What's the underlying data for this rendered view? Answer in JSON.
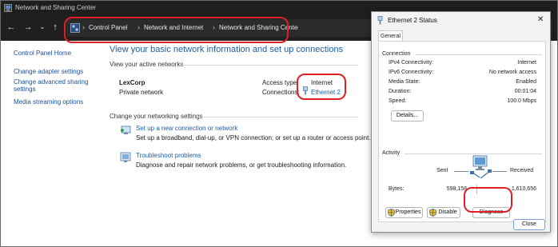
{
  "window": {
    "title": "Network and Sharing Center"
  },
  "address_bar": {
    "crumbs": [
      "Control Panel",
      "Network and Internet",
      "Network and Sharing Center"
    ]
  },
  "left_nav": [
    "Control Panel Home",
    "Change adapter settings",
    "Change advanced sharing settings",
    "Media streaming options"
  ],
  "main": {
    "heading": "View your basic network information and set up connections",
    "active_networks_label": "View your active networks",
    "network_name": "LexCorp",
    "network_type": "Private network",
    "access_type_label": "Access type:",
    "access_type_value": "Internet",
    "connections_label": "Connections:",
    "connections_value": "Ethernet 2",
    "change_settings_label": "Change your networking settings",
    "setup_link": "Set up a new connection or network",
    "setup_desc": "Set up a broadband, dial-up, or VPN connection; or set up a router or access point.",
    "troubleshoot_link": "Troubleshoot problems",
    "troubleshoot_desc": "Diagnose and repair network problems, or get troubleshooting information."
  },
  "dialog": {
    "title": "Ethernet 2 Status",
    "close_glyph": "✕",
    "tab": "General",
    "connection_group": "Connection",
    "rows": [
      {
        "label": "IPv4 Connectivity:",
        "value": "Internet"
      },
      {
        "label": "IPv6 Connectivity:",
        "value": "No network access"
      },
      {
        "label": "Media State:",
        "value": "Enabled"
      },
      {
        "label": "Duration:",
        "value": "00:01:04"
      },
      {
        "label": "Speed:",
        "value": "100.0 Mbps"
      }
    ],
    "details_button": "Details...",
    "activity_group": "Activity",
    "sent_label": "Sent",
    "received_label": "Received",
    "bytes_label": "Bytes:",
    "bytes_sent": "598,158",
    "bytes_received": "1,610,656",
    "properties_button": "Properties",
    "disable_button": "Disable",
    "diagnose_button": "Diagnose",
    "close_button": "Close"
  },
  "colors": {
    "highlight": "#e01f26",
    "link": "#1a5ea8",
    "titlebar": "#1e1e1e"
  }
}
